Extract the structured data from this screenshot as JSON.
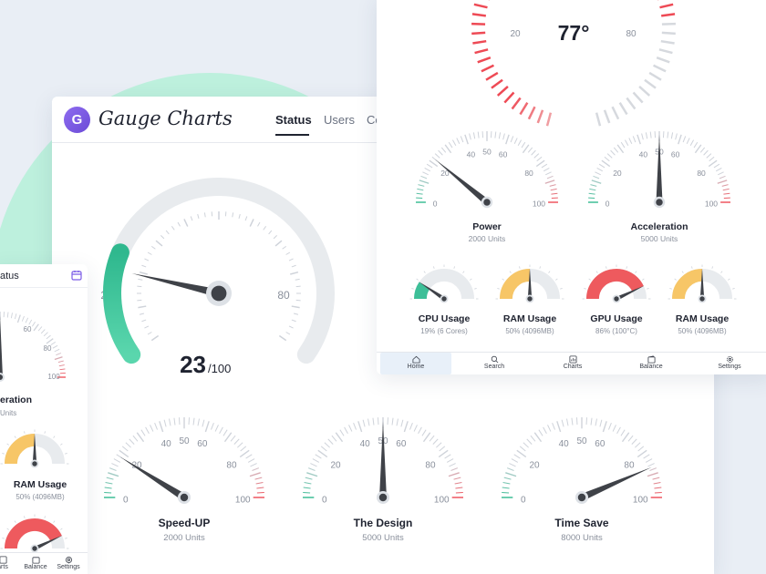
{
  "colors": {
    "green": "#3dbf98",
    "red": "#ee5a5e",
    "yellow": "#f7c667",
    "needle": "#3f4248",
    "track": "#e8ebee",
    "purple": "#7b5ce6"
  },
  "app": {
    "logo_letter": "G",
    "brand": "Gauge Charts"
  },
  "main_tabs": [
    {
      "label": "Status"
    },
    {
      "label": "Users"
    },
    {
      "label": "Co"
    }
  ],
  "big_gauge": {
    "value": 23,
    "max": "/100",
    "left_tick": "20",
    "right_tick": "80"
  },
  "main_gauges": [
    {
      "title": "Speed-UP",
      "subtitle": "2000 Units",
      "value": 18
    },
    {
      "title": "The Design",
      "subtitle": "5000 Units",
      "value": 50
    },
    {
      "title": "Time Save",
      "subtitle": "8000 Units",
      "value": 87
    }
  ],
  "gauge_ticks": [
    "0",
    "20",
    "40",
    "50",
    "60",
    "80",
    "100"
  ],
  "right_top": {
    "value": "77°",
    "left_tick": "20",
    "right_tick": "80"
  },
  "right_gauges": [
    {
      "title": "Power",
      "subtitle": "2000 Units",
      "value": 22
    },
    {
      "title": "Acceleration",
      "subtitle": "5000 Units",
      "value": 50
    }
  ],
  "small_gauges": [
    {
      "title": "CPU Usage",
      "subtitle": "19% (6 Cores)",
      "value": 19,
      "color": "#3dbf98"
    },
    {
      "title": "RAM Usage",
      "subtitle": "50% (4096MB)",
      "value": 50,
      "color": "#f7c667"
    },
    {
      "title": "GPU Usage",
      "subtitle": "86% (100°C)",
      "value": 86,
      "color": "#ee5a5e"
    },
    {
      "title": "RAM Usage",
      "subtitle": "50% (4096MB)",
      "value": 50,
      "color": "#f7c667"
    }
  ],
  "right_nav": [
    {
      "label": "Home",
      "icon": "home-icon"
    },
    {
      "label": "Search",
      "icon": "search-icon"
    },
    {
      "label": "Charts",
      "icon": "charts-icon"
    },
    {
      "label": "Balance",
      "icon": "wallet-icon"
    },
    {
      "label": "Settings",
      "icon": "gear-icon"
    }
  ],
  "left_card": {
    "tab_partial": "atus",
    "ticks": [
      "60",
      "80",
      "100"
    ],
    "title_partial": "eration",
    "subtitle_partial": "Units",
    "ram_title": "RAM Usage",
    "ram_subtitle": "50% (4096MB)",
    "ram_value": 50,
    "bottom_value": 86,
    "nav": [
      "arts",
      "Balance",
      "Settings"
    ]
  }
}
